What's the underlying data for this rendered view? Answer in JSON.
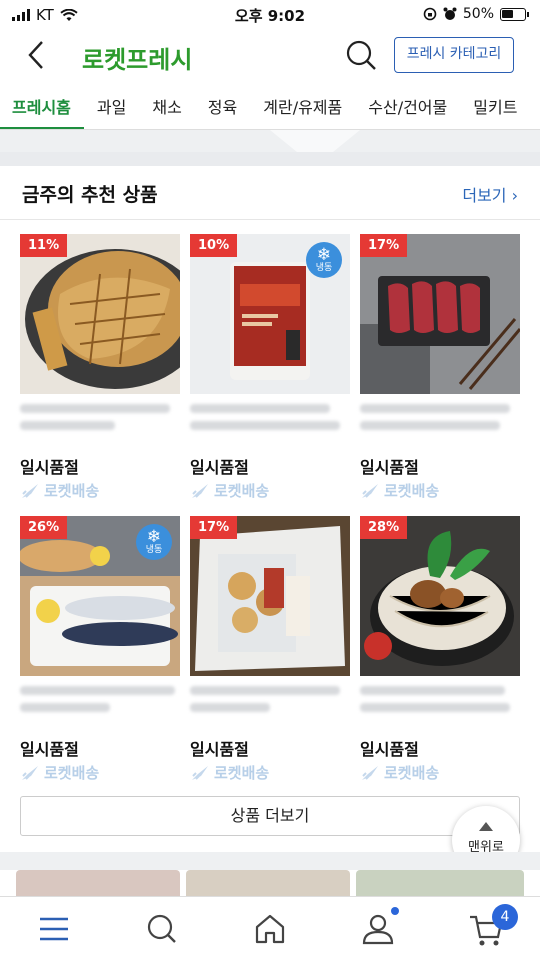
{
  "status_bar": {
    "carrier": "KT",
    "time": "오후 9:02",
    "battery": "50%"
  },
  "header": {
    "logo": "로켓프레시",
    "category_button": "프레시 카테고리"
  },
  "tabs": [
    "프레시홈",
    "과일",
    "채소",
    "정육",
    "계란/유제품",
    "수산/건어물",
    "밀키트"
  ],
  "section": {
    "title": "금주의 추천 상품",
    "more_link": "더보기 ›"
  },
  "products": [
    {
      "discount": "11%",
      "status": "일시품절",
      "delivery": "로켓배송",
      "frozen": false
    },
    {
      "discount": "10%",
      "status": "일시품절",
      "delivery": "로켓배송",
      "frozen": true,
      "frozen_label": "냉동"
    },
    {
      "discount": "17%",
      "status": "일시품절",
      "delivery": "로켓배송",
      "frozen": false
    },
    {
      "discount": "26%",
      "status": "일시품절",
      "delivery": "로켓배송",
      "frozen": true,
      "frozen_label": "냉동"
    },
    {
      "discount": "17%",
      "status": "일시품절",
      "delivery": "로켓배송",
      "frozen": false
    },
    {
      "discount": "28%",
      "status": "일시품절",
      "delivery": "로켓배송",
      "frozen": false
    }
  ],
  "more_products_button": "상품 더보기",
  "to_top_button": "맨위로",
  "bottom_nav": {
    "cart_count": "4"
  },
  "colors": {
    "brand_green": "#2d9b2d",
    "link_blue": "#2b66b8",
    "discount_red": "#e53935",
    "frozen_blue": "#3b8fdc"
  }
}
